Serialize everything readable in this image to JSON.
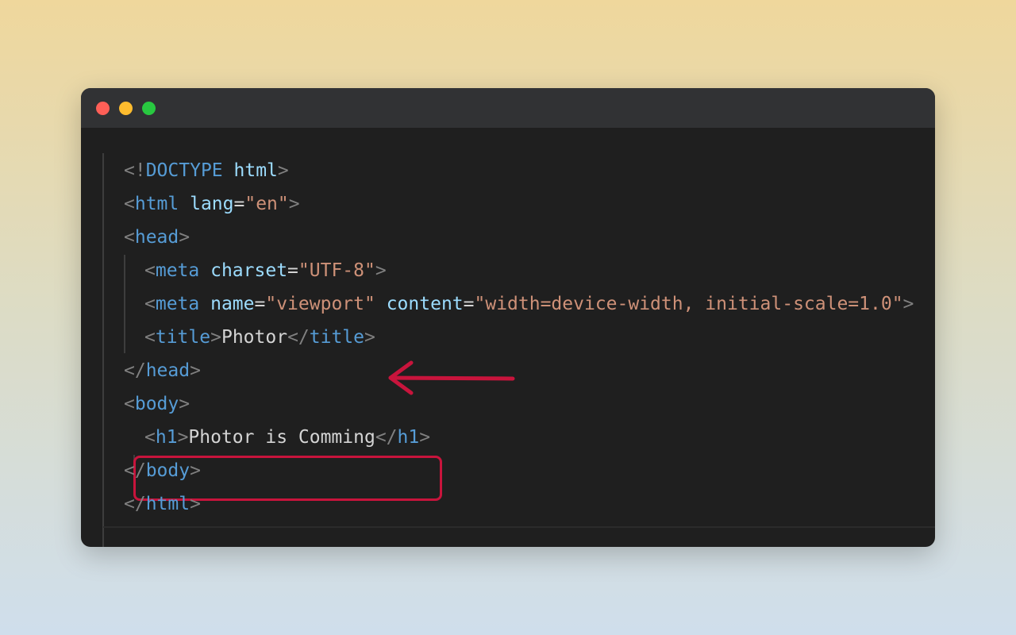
{
  "window": {
    "controls": [
      "close-dot",
      "minimize-dot",
      "zoom-dot"
    ]
  },
  "code": {
    "lines": [
      [
        {
          "text": "<!",
          "k": "p"
        },
        {
          "text": "DOCTYPE",
          "k": "t"
        },
        {
          "text": " ",
          "k": "x"
        },
        {
          "text": "html",
          "k": "a"
        },
        {
          "text": ">",
          "k": "p"
        }
      ],
      [
        {
          "text": "<",
          "k": "p"
        },
        {
          "text": "html",
          "k": "t"
        },
        {
          "text": " ",
          "k": "x"
        },
        {
          "text": "lang",
          "k": "a"
        },
        {
          "text": "=",
          "k": "x"
        },
        {
          "text": "\"en\"",
          "k": "s"
        },
        {
          "text": ">",
          "k": "p"
        }
      ],
      [
        {
          "text": "<",
          "k": "p"
        },
        {
          "text": "head",
          "k": "t"
        },
        {
          "text": ">",
          "k": "p"
        }
      ],
      [
        {
          "text": "<",
          "k": "p"
        },
        {
          "text": "meta",
          "k": "t"
        },
        {
          "text": " ",
          "k": "x"
        },
        {
          "text": "charset",
          "k": "a"
        },
        {
          "text": "=",
          "k": "x"
        },
        {
          "text": "\"UTF-8\"",
          "k": "s"
        },
        {
          "text": ">",
          "k": "p"
        }
      ],
      [
        {
          "text": "<",
          "k": "p"
        },
        {
          "text": "meta",
          "k": "t"
        },
        {
          "text": " ",
          "k": "x"
        },
        {
          "text": "name",
          "k": "a"
        },
        {
          "text": "=",
          "k": "x"
        },
        {
          "text": "\"viewport\"",
          "k": "s"
        },
        {
          "text": " ",
          "k": "x"
        },
        {
          "text": "content",
          "k": "a"
        },
        {
          "text": "=",
          "k": "x"
        },
        {
          "text": "\"width=device-width, initial-scale=1.0\"",
          "k": "s"
        },
        {
          "text": ">",
          "k": "p"
        }
      ],
      [
        {
          "text": "<",
          "k": "p"
        },
        {
          "text": "title",
          "k": "t"
        },
        {
          "text": ">",
          "k": "p"
        },
        {
          "text": "Photor",
          "k": "x"
        },
        {
          "text": "</",
          "k": "p"
        },
        {
          "text": "title",
          "k": "t"
        },
        {
          "text": ">",
          "k": "p"
        }
      ],
      [
        {
          "text": "</",
          "k": "p"
        },
        {
          "text": "head",
          "k": "t"
        },
        {
          "text": ">",
          "k": "p"
        }
      ],
      [
        {
          "text": "<",
          "k": "p"
        },
        {
          "text": "body",
          "k": "t"
        },
        {
          "text": ">",
          "k": "p"
        }
      ],
      [
        {
          "text": "<",
          "k": "p"
        },
        {
          "text": "h1",
          "k": "t"
        },
        {
          "text": ">",
          "k": "p"
        },
        {
          "text": "Photor is Comming",
          "k": "x"
        },
        {
          "text": "</",
          "k": "p"
        },
        {
          "text": "h1",
          "k": "t"
        },
        {
          "text": ">",
          "k": "p"
        }
      ],
      [
        {
          "text": "</",
          "k": "p"
        },
        {
          "text": "body",
          "k": "t"
        },
        {
          "text": ">",
          "k": "p"
        }
      ],
      [
        {
          "text": "</",
          "k": "p"
        },
        {
          "text": "html",
          "k": "t"
        },
        {
          "text": ">",
          "k": "p"
        }
      ]
    ]
  },
  "annotations": {
    "color": "#c8143c",
    "arrow_target": "title-tag",
    "box_target": "h1-tag"
  }
}
